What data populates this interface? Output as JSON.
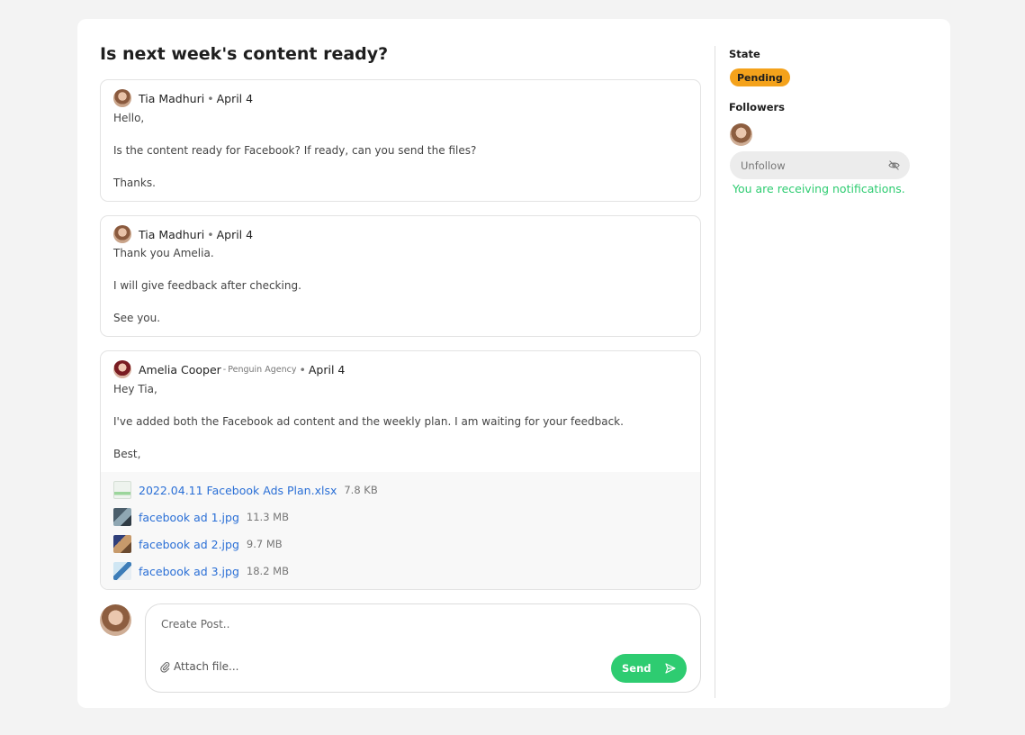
{
  "thread": {
    "title": "Is next week's content ready?"
  },
  "posts": [
    {
      "author": "Tia Madhuri",
      "agency": "",
      "date": "April 4",
      "lines": [
        "Hello,",
        "Is the content ready for Facebook? If ready, can you send the files?",
        "Thanks."
      ]
    },
    {
      "author": "Tia Madhuri",
      "agency": "",
      "date": "April 4",
      "lines": [
        "Thank you Amelia.",
        "I will give feedback after checking.",
        "See you."
      ]
    },
    {
      "author": "Amelia Cooper",
      "agency": "Penguin Agency",
      "date": "April 4",
      "lines": [
        "Hey Tia,",
        "I've added both the Facebook ad content and the weekly plan. I am waiting for your feedback.",
        "Best,"
      ],
      "attachments": [
        {
          "name": "2022.04.11 Facebook Ads Plan.xlsx",
          "size": "7.8 KB",
          "icon": "spreadsheet-icon"
        },
        {
          "name": "facebook ad 1.jpg",
          "size": "11.3 MB",
          "icon": "image-thumbnail-icon"
        },
        {
          "name": "facebook ad 2.jpg",
          "size": "9.7 MB",
          "icon": "image-thumbnail-icon"
        },
        {
          "name": "facebook ad 3.jpg",
          "size": "18.2 MB",
          "icon": "image-thumbnail-icon"
        }
      ]
    }
  ],
  "composer": {
    "placeholder": "Create Post..",
    "value": "",
    "attach_label": "Attach file...",
    "send_label": "Send"
  },
  "sidebar": {
    "state_label": "State",
    "state_value": "Pending",
    "followers_label": "Followers",
    "unfollow_label": "Unfollow",
    "notification_text": "You are receiving notifications."
  },
  "colors": {
    "accent_green": "#2ecc71",
    "pending": "#f4a21b",
    "link": "#2a6fd6"
  },
  "separator": "•",
  "agency_separator": "-"
}
